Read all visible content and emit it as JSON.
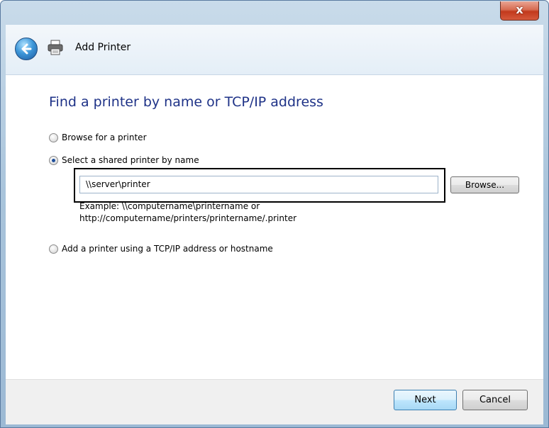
{
  "window": {
    "title": "Add Printer",
    "close_glyph": "x"
  },
  "icons": {
    "back": "back-arrow-icon",
    "printer": "printer-icon"
  },
  "main": {
    "heading": "Find a printer by name or TCP/IP address",
    "options": [
      {
        "label": "Browse for a printer",
        "selected": false
      },
      {
        "label": "Select a shared printer by name",
        "selected": true
      },
      {
        "label": "Add a printer using a TCP/IP address or hostname",
        "selected": false
      }
    ],
    "printer_name_value": "\\\\server\\printer",
    "browse_label": "Browse...",
    "example_line1": "Example: \\\\computername\\printername or",
    "example_line2": "http://computername/printers/printername/.printer"
  },
  "footer": {
    "next_label": "Next",
    "cancel_label": "Cancel"
  },
  "colors": {
    "heading": "#1e3287",
    "close_button": "#c2391c",
    "highlight_border": "#000000"
  }
}
